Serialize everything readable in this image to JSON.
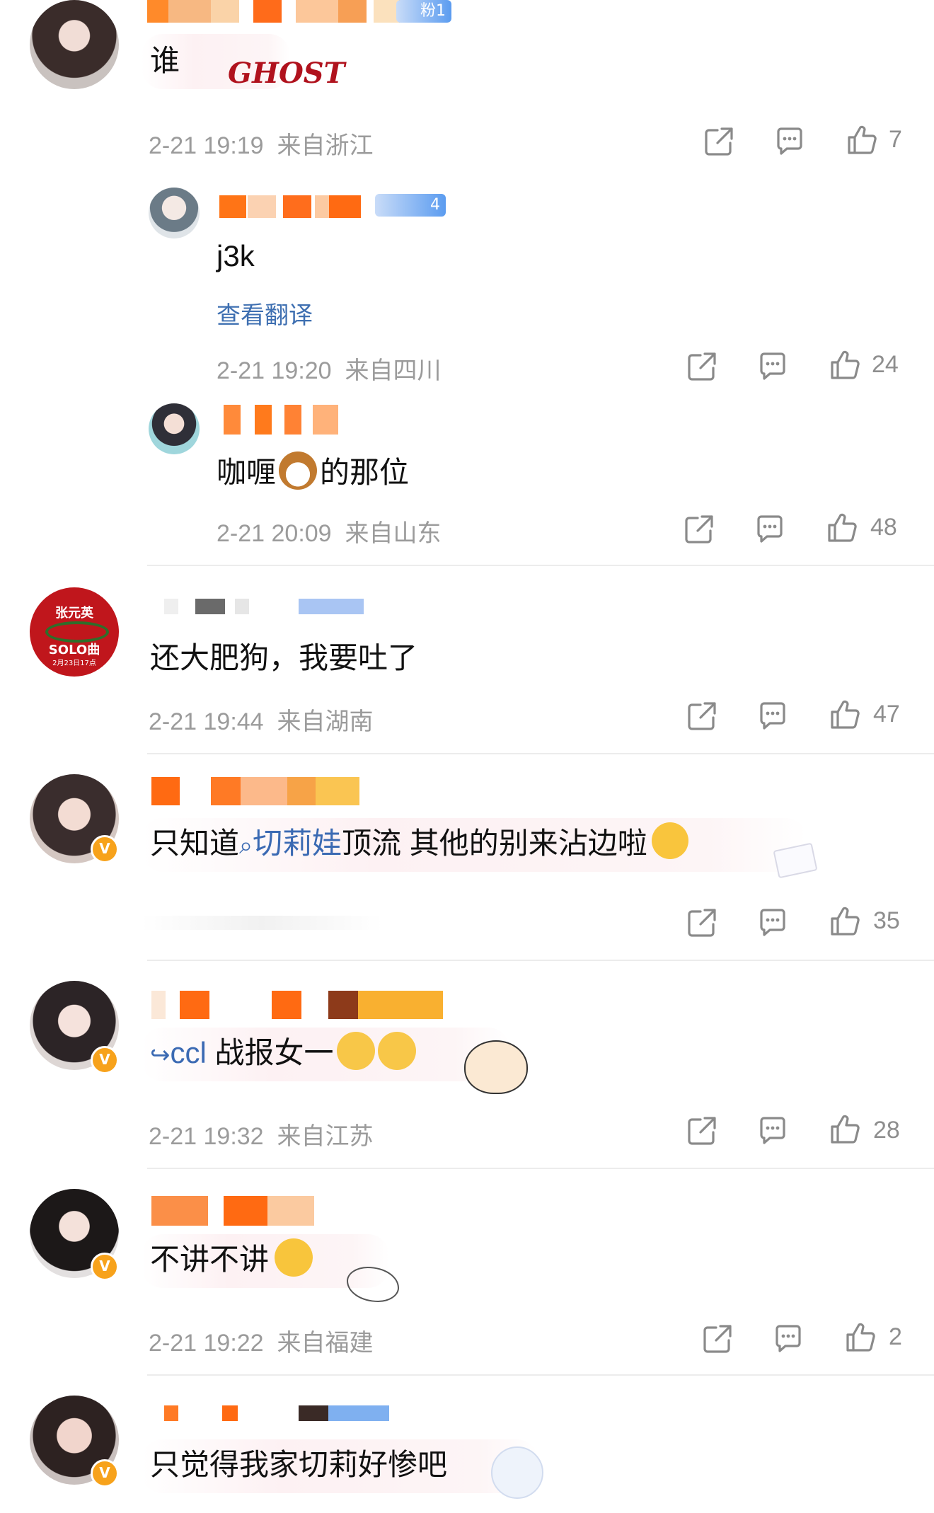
{
  "colors": {
    "meta": "#9b9b9b",
    "link": "#3e6fb1",
    "badge": "#f7a21b",
    "divider": "#ececec"
  },
  "comments": [
    {
      "badge": "粉1",
      "text": "谁",
      "sticker": "GHOST",
      "time": "2-21 19:19",
      "location": "来自浙江",
      "likes": "7"
    },
    {
      "badge": "4",
      "text": "j3k",
      "translate": "查看翻译",
      "time": "2-21 19:20",
      "location": "来自四川",
      "likes": "24"
    },
    {
      "text_a": "咖喱",
      "text_b": "的那位",
      "emoji": "dog-emoji",
      "time": "2-21 20:09",
      "location": "来自山东",
      "likes": "48"
    },
    {
      "avatar_text_1": "张元英",
      "avatar_text_2": "SOLO曲",
      "avatar_text_3": "2月23日17点",
      "text": "还大肥狗，我要吐了",
      "time": "2-21 19:44",
      "location": "来自湖南",
      "likes": "47"
    },
    {
      "text_a": "只知道",
      "topic": "切莉娃",
      "text_b": "顶流 其他的别来沾边啦",
      "likes": "35"
    },
    {
      "handle": "ccl",
      "text": "战报女一",
      "time": "2-21 19:32",
      "location": "来自江苏",
      "likes": "28"
    },
    {
      "text": "不讲不讲",
      "time": "2-21 19:22",
      "location": "来自福建",
      "likes": "2"
    },
    {
      "text": "只觉得我家切莉好惨吧"
    }
  ]
}
